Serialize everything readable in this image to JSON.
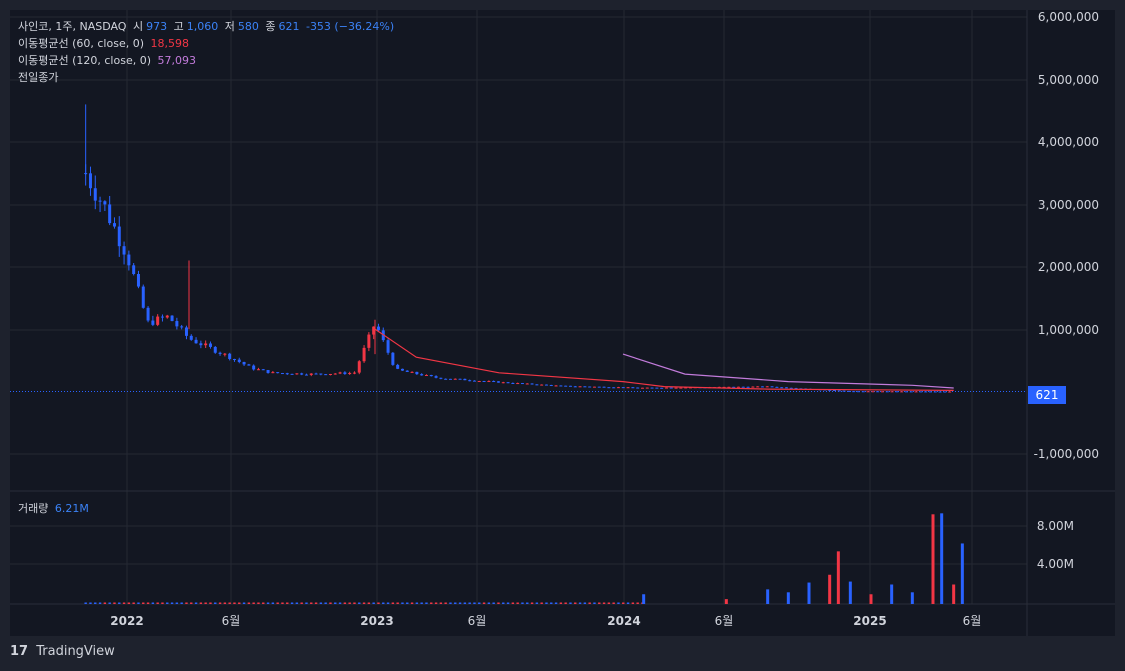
{
  "header": {
    "symbol": "사인코, 1주, NASDAQ",
    "o_label": "시",
    "o_val": "973",
    "h_label": "고",
    "h_val": "1,060",
    "l_label": "저",
    "l_val": "580",
    "c_label": "종",
    "c_val": "621",
    "change": "-353 (−36.24%)"
  },
  "indicators": [
    {
      "label": "이동평균선 (60, close, 0)",
      "value": "18,598",
      "color": "#f23645"
    },
    {
      "label": "이동평균선 (120, close, 0)",
      "value": "57,093",
      "color": "#c27bdb"
    },
    {
      "label": "전일종가",
      "value": ""
    }
  ],
  "volume_legend": {
    "label": "거래량",
    "value": "6.21M"
  },
  "price_tag": "621",
  "footer": {
    "brand": "TradingView",
    "logo": "17"
  },
  "colors": {
    "up": "#f23645",
    "down": "#2962ff",
    "bg": "#131722",
    "grid": "#242833"
  },
  "chart_data": [
    {
      "type": "candlestick",
      "title": "사인코, 1주, NASDAQ",
      "x_ticks": [
        "2022",
        "6월",
        "2023",
        "6월",
        "2024",
        "6월",
        "2025",
        "6월"
      ],
      "y_ticks": [
        "6,000,000",
        "5,000,000",
        "4,000,000",
        "3,000,000",
        "2,000,000",
        "1,000,000",
        "-1,000,000"
      ],
      "ylim": [
        -1000000,
        6000000
      ],
      "grid": true,
      "last_close": 621,
      "series_description": "Weekly candles declining from ~3,500,000 (late 2021) to ~621 (mid 2025); spike ~1,100,000 at start of 2023",
      "approx_closes": [
        {
          "x": "2021-11",
          "y": 3500000
        },
        {
          "x": "2021-12",
          "y": 2900000
        },
        {
          "x": "2022-01",
          "y": 2200000
        },
        {
          "x": "2022-02",
          "y": 1100000
        },
        {
          "x": "2022-03",
          "y": 1200000
        },
        {
          "x": "2022-04",
          "y": 850000
        },
        {
          "x": "2022-05",
          "y": 700000
        },
        {
          "x": "2022-06",
          "y": 550000
        },
        {
          "x": "2022-07",
          "y": 380000
        },
        {
          "x": "2022-08",
          "y": 300000
        },
        {
          "x": "2022-10",
          "y": 280000
        },
        {
          "x": "2022-12",
          "y": 300000
        },
        {
          "x": "2023-01",
          "y": 1100000
        },
        {
          "x": "2023-02",
          "y": 350000
        },
        {
          "x": "2023-04",
          "y": 220000
        },
        {
          "x": "2023-07",
          "y": 150000
        },
        {
          "x": "2023-10",
          "y": 90000
        },
        {
          "x": "2024-02",
          "y": 60000
        },
        {
          "x": "2024-08",
          "y": 80000
        },
        {
          "x": "2024-12",
          "y": 5000
        },
        {
          "x": "2025-05",
          "y": 621
        }
      ],
      "ma60": [
        {
          "x": "2023-01",
          "y": 1000000
        },
        {
          "x": "2023-03",
          "y": 550000
        },
        {
          "x": "2023-07",
          "y": 300000
        },
        {
          "x": "2024-01",
          "y": 160000
        },
        {
          "x": "2024-03",
          "y": 80000
        },
        {
          "x": "2024-08",
          "y": 40000
        },
        {
          "x": "2025-05",
          "y": 18598
        }
      ],
      "ma120": [
        {
          "x": "2024-01",
          "y": 600000
        },
        {
          "x": "2024-04",
          "y": 280000
        },
        {
          "x": "2024-09",
          "y": 160000
        },
        {
          "x": "2025-03",
          "y": 100000
        },
        {
          "x": "2025-05",
          "y": 57093
        }
      ]
    },
    {
      "type": "bar",
      "title": "거래량",
      "y_ticks": [
        "8.00M",
        "4.00M"
      ],
      "last_value": "6.21M",
      "bars": [
        {
          "x": "2024-02",
          "y": 1000000,
          "dir": "down"
        },
        {
          "x": "2024-06",
          "y": 500000,
          "dir": "up"
        },
        {
          "x": "2024-08",
          "y": 1500000,
          "dir": "down"
        },
        {
          "x": "2024-09",
          "y": 1200000,
          "dir": "down"
        },
        {
          "x": "2024-10",
          "y": 2200000,
          "dir": "down"
        },
        {
          "x": "2024-11",
          "y": 3000000,
          "dir": "up"
        },
        {
          "x": "2024-11b",
          "y": 5400000,
          "dir": "up"
        },
        {
          "x": "2024-12",
          "y": 2300000,
          "dir": "down"
        },
        {
          "x": "2025-01",
          "y": 1000000,
          "dir": "up"
        },
        {
          "x": "2025-02",
          "y": 2000000,
          "dir": "down"
        },
        {
          "x": "2025-03",
          "y": 1200000,
          "dir": "down"
        },
        {
          "x": "2025-04",
          "y": 9200000,
          "dir": "up"
        },
        {
          "x": "2025-04b",
          "y": 9300000,
          "dir": "down"
        },
        {
          "x": "2025-05",
          "y": 2000000,
          "dir": "up"
        },
        {
          "x": "2025-05b",
          "y": 6210000,
          "dir": "down"
        }
      ]
    }
  ]
}
